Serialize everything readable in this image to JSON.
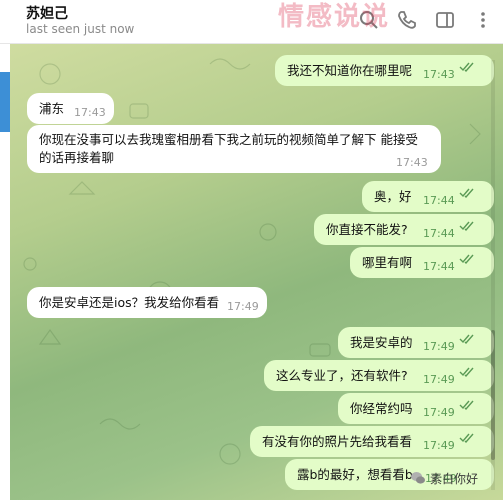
{
  "header": {
    "title": "苏妲己",
    "status": "last seen just now",
    "icons": [
      "search-icon",
      "phone-icon",
      "sidebar-toggle-icon",
      "more-icon"
    ]
  },
  "watermark_top": "情感说说",
  "watermark_bottom": "素白你好",
  "colors": {
    "outgoing": "#e3fcc8",
    "incoming": "#ffffff",
    "time_out": "#5a9a55",
    "accent": "#3d8fd6"
  },
  "messages": [
    {
      "dir": "out",
      "text": "我还不知道你在哪里呢",
      "time": "17:43"
    },
    {
      "dir": "in",
      "sender": "浦东",
      "time": "17:43"
    },
    {
      "dir": "in",
      "line1": "你现在没事可以去我瑰蜜相册看下我之前玩的视频简单了解下 能接受",
      "line2": "的话再接着聊",
      "time": "17:43"
    },
    {
      "dir": "out",
      "text": "奥，好",
      "time": "17:44"
    },
    {
      "dir": "out",
      "text": "你直接不能发?",
      "time": "17:44"
    },
    {
      "dir": "out",
      "text": "哪里有啊",
      "time": "17:44"
    },
    {
      "dir": "in",
      "text": "你是安卓还是ios？我发给你看看",
      "time": "17:49"
    },
    {
      "dir": "out",
      "text": "我是安卓的",
      "time": "17:49"
    },
    {
      "dir": "out",
      "text": "这么专业了，还有软件?",
      "time": "17:49"
    },
    {
      "dir": "out",
      "text": "你经常约吗",
      "time": "17:49"
    },
    {
      "dir": "out",
      "text": "有没有你的照片先给我看看",
      "time": "17:49"
    },
    {
      "dir": "out",
      "text": "露b的最好，想看看b",
      "time": "17:49"
    }
  ]
}
